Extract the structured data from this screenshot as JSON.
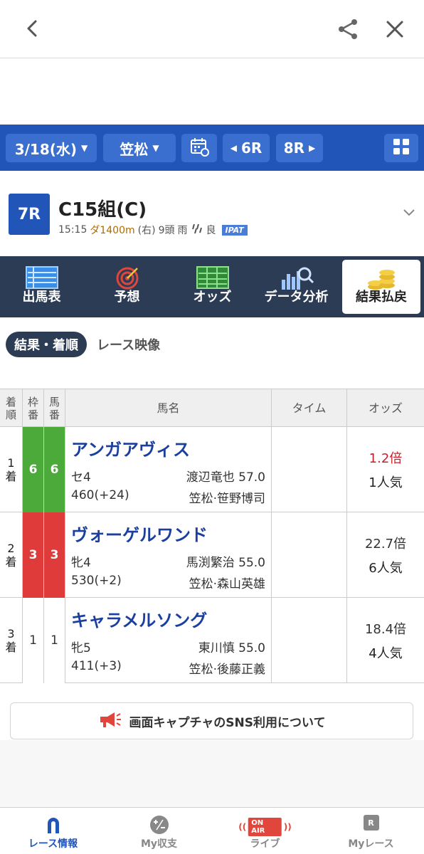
{
  "nav": {
    "date": "3/18(水)",
    "place": "笠松",
    "prev_race": "6R",
    "next_race": "8R"
  },
  "race": {
    "number": "7R",
    "title": "C15組(C)",
    "time": "15:15",
    "course": "ダ1400m",
    "direction": "(右)",
    "runners": "9頭",
    "weather": "雨",
    "going": "良",
    "ipat": "IPAT"
  },
  "tabs": [
    {
      "label": "出馬表",
      "icon": "race-card-icon"
    },
    {
      "label": "予想",
      "icon": "target-icon"
    },
    {
      "label": "オッズ",
      "icon": "odds-board-icon"
    },
    {
      "label": "データ分析",
      "icon": "chart-magnifier-icon"
    },
    {
      "label": "結果払戻",
      "icon": "coins-icon"
    }
  ],
  "subtabs": {
    "active": "結果・着順",
    "other": "レース映像"
  },
  "table": {
    "headers": {
      "pos": "着順",
      "waku": "枠番",
      "uma": "馬番",
      "horse": "馬名",
      "time": "タイム",
      "odds": "オッズ"
    },
    "rows": [
      {
        "pos": "1着",
        "waku": "6",
        "uma": "6",
        "waku_color": "#4caa3b",
        "name": "アンガアヴィス",
        "sex_age": "セ4",
        "jockey_weight": "渡辺竜也 57.0",
        "body_weight": "460(+24)",
        "trainer": "笠松·笹野博司",
        "odds": "1.2倍",
        "odds_color": "#c8202a",
        "popularity": "1人気"
      },
      {
        "pos": "2着",
        "waku": "3",
        "uma": "3",
        "waku_color": "#e03b3b",
        "name": "ヴォーゲルワンド",
        "sex_age": "牝4",
        "jockey_weight": "馬渕繁治 55.0",
        "body_weight": "530(+2)",
        "trainer": "笠松·森山英雄",
        "odds": "22.7倍",
        "odds_color": "#333333",
        "popularity": "6人気"
      },
      {
        "pos": "3着",
        "waku": "1",
        "uma": "1",
        "waku_color": "#ffffff",
        "name": "キャラメルソング",
        "sex_age": "牝5",
        "jockey_weight": "東川慎 55.0",
        "body_weight": "411(+3)",
        "trainer": "笠松·後藤正義",
        "odds": "18.4倍",
        "odds_color": "#333333",
        "popularity": "4人気"
      }
    ]
  },
  "sns_notice": "画面キャプチャのSNS利用について",
  "bottom_nav": [
    {
      "label": "レース情報",
      "icon": "horseshoe-icon"
    },
    {
      "label": "My収支",
      "icon": "plus-minus-icon"
    },
    {
      "label": "ライブ",
      "icon": "on-air-icon",
      "badge": "ON AIR"
    },
    {
      "label": "Myレース",
      "icon": "my-race-icon",
      "badge": "R"
    }
  ],
  "colors": {
    "primary_blue": "#2156b8",
    "dark_navy": "#2d3c55",
    "horse_name": "#1a3f9e"
  }
}
